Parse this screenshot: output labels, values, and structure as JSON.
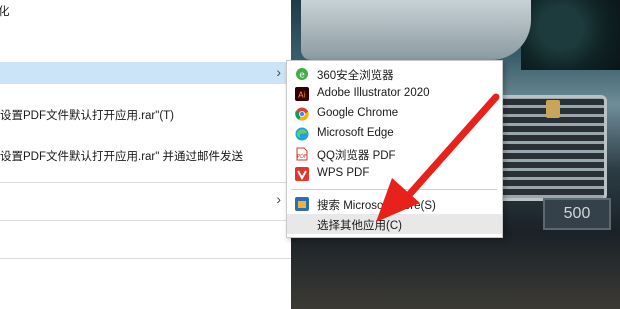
{
  "parent_menu": {
    "top_partial": "化",
    "item_share_label": "设置PDF文件默认打开应用.rar\"(T)",
    "item_email_label": "设置PDF文件默认打开应用.rar\" 并通过邮件发送"
  },
  "submenu": {
    "items": [
      {
        "label": "360安全浏览器",
        "icon": "browser-360-icon"
      },
      {
        "label": "Adobe Illustrator 2020",
        "icon": "adobe-illustrator-icon"
      },
      {
        "label": "Google Chrome",
        "icon": "chrome-icon"
      },
      {
        "label": "Microsoft Edge",
        "icon": "edge-icon"
      },
      {
        "label": "QQ浏览器 PDF",
        "icon": "qq-browser-pdf-icon"
      },
      {
        "label": "WPS PDF",
        "icon": "wps-pdf-icon"
      },
      {
        "label": "搜索 Microsoft Store(S)",
        "icon": "microsoft-store-icon"
      },
      {
        "label": "选择其他应用(C)",
        "icon": ""
      }
    ]
  },
  "desktop": {
    "plate_text": "500"
  },
  "colors": {
    "highlight": "#cce4f7",
    "arrow": "#e8221b"
  }
}
